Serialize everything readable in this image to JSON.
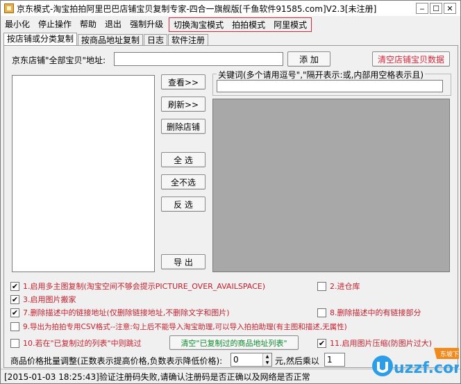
{
  "window": {
    "title": "京东模式-淘宝拍拍阿里巴巴店铺宝贝复制专家-四合一旗舰版[千鱼软件91585.com]V2.3[未注册]"
  },
  "menu": {
    "items": [
      "最小化",
      "停止操作",
      "帮助",
      "退出",
      "强制升级"
    ],
    "mode_items": [
      "切换淘宝模式",
      "拍拍模式",
      "阿里模式"
    ]
  },
  "tabs": [
    "按店铺或分类复制",
    "按商品地址复制",
    "日志",
    "软件注册"
  ],
  "store": {
    "address_label": "京东店铺\"全部宝贝\"地址:",
    "address_value": "",
    "add_button": "添  加",
    "clear_button": "清空店铺宝贝数据"
  },
  "keyword": {
    "label": "关键词(多个请用逗号\",\"隔开表示:或,内部用空格表示且)",
    "value": ""
  },
  "actions": {
    "view": "查看>>",
    "refresh": "刷新>>",
    "delete_store": "删除店铺",
    "select_all": "全  选",
    "select_none": "全不选",
    "invert": "反  选",
    "export": "导  出"
  },
  "options": [
    {
      "id": 1,
      "label": "1.启用多主图复制(淘宝空间不够会提示PICTURE_OVER_AVAILSPACE)",
      "checked": true,
      "color": "red"
    },
    {
      "id": 2,
      "label": "2.进仓库",
      "checked": false,
      "color": "red"
    },
    {
      "id": 3,
      "label": "3.启用图片搬家",
      "checked": true,
      "color": "red"
    },
    {
      "id": 7,
      "label": "7.删除描述中的链接地址(仅删除链接地址,不删除文字和图片)",
      "checked": true,
      "color": "red"
    },
    {
      "id": 8,
      "label": "8.删除描述中的有链接部分",
      "checked": false,
      "color": "red"
    },
    {
      "id": 9,
      "label": "9.导出为拍拍专用CSV格式--注意:勾上后不能导入淘宝助理,可以导入拍拍助理(有主图和描述,无属性)",
      "checked": false,
      "color": "red"
    },
    {
      "id": 10,
      "label": "10.若在\"已复制过的列表\"中则跳过",
      "checked": false,
      "color": "red"
    },
    {
      "id": 11,
      "label": "11.启用图片压缩(防图片过大)",
      "checked": true,
      "color": "red"
    }
  ],
  "copied_list_button": "清空\"已复制过的商品地址列表\"",
  "price": {
    "label": "商品价格批量调整(正数表示提高价格,负数表示降低价格):",
    "value": "0",
    "unit_label": "元,然后乘以",
    "multiplier": "1"
  },
  "status": "[2015-01-03 18:25:43]验证注册码失败,请确认注册码是否正确以及网络是否正常",
  "watermark": {
    "domain_text": "uzzf.com",
    "badge_text": "东坡下载"
  },
  "colors": {
    "accent_red": "#d9263a",
    "option_red": "#c41e2c",
    "button_green": "#0a8a2a",
    "gray_panel": "#a8a8a8"
  }
}
